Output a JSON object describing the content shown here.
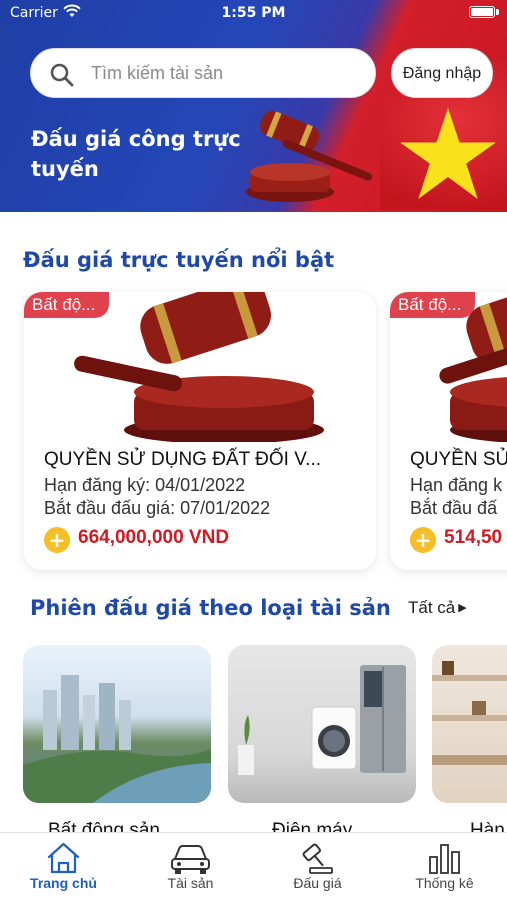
{
  "status_bar": {
    "carrier": "Carrier",
    "time": "1:55 PM"
  },
  "header": {
    "search_placeholder": "Tìm kiếm tài sản",
    "login_label": "Đăng nhập",
    "banner_title": "Đấu giá công trực tuyến"
  },
  "featured": {
    "title": "Đấu giá trực tuyến nổi bật",
    "cards": [
      {
        "tag": "Bất độ...",
        "title": "QUYỀN SỬ DỤNG ĐẤT ĐỐI V...",
        "register_deadline": "Hạn đăng ký: 04/01/2022",
        "start_date": "Bắt đầu đấu giá: 07/01/2022",
        "price": "664,000,000 VND"
      },
      {
        "tag": "Bất độ...",
        "title": "QUYỀN SỬ",
        "register_deadline": "Hạn đăng k",
        "start_date": "Bắt đầu đấ",
        "price": "514,50"
      }
    ]
  },
  "categories": {
    "title": "Phiên đấu giá theo loại tài sản",
    "see_all": "Tất cả",
    "items": [
      {
        "label": "Bất động sản"
      },
      {
        "label": "Điện máy"
      },
      {
        "label": "Hàn"
      }
    ]
  },
  "tabbar": {
    "items": [
      {
        "label": "Trang chủ",
        "icon": "home-icon",
        "active": true
      },
      {
        "label": "Tài sản",
        "icon": "car-icon",
        "active": false
      },
      {
        "label": "Đấu giá",
        "icon": "gavel-icon",
        "active": false
      },
      {
        "label": "Thống kê",
        "icon": "bar-chart-icon",
        "active": false
      }
    ]
  },
  "colors": {
    "primary": "#1f49a8",
    "accent_red": "#d11a21",
    "tag_red": "#e0424d",
    "coin": "#f6bf27",
    "tab_active": "#1f5fc4"
  }
}
